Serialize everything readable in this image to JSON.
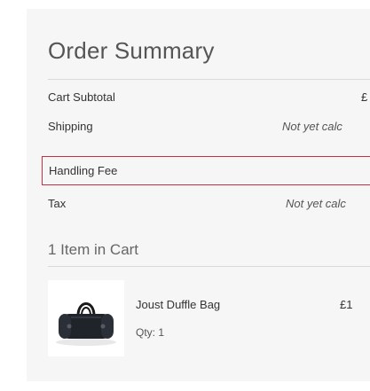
{
  "order_summary": {
    "title": "Order Summary",
    "rows": [
      {
        "label": "Cart Subtotal",
        "value": "£"
      },
      {
        "label": "Shipping",
        "value": "Not yet calc"
      },
      {
        "label": "Handling Fee",
        "value": ""
      },
      {
        "label": "Tax",
        "value": "Not yet calc"
      }
    ],
    "highlight_color": "#c7303e"
  },
  "cart": {
    "heading": "1 Item in Cart",
    "items": [
      {
        "name": "Joust Duffle Bag",
        "price": "£1",
        "qty": "Qty: 1",
        "icon": "duffle-bag-image"
      }
    ]
  }
}
